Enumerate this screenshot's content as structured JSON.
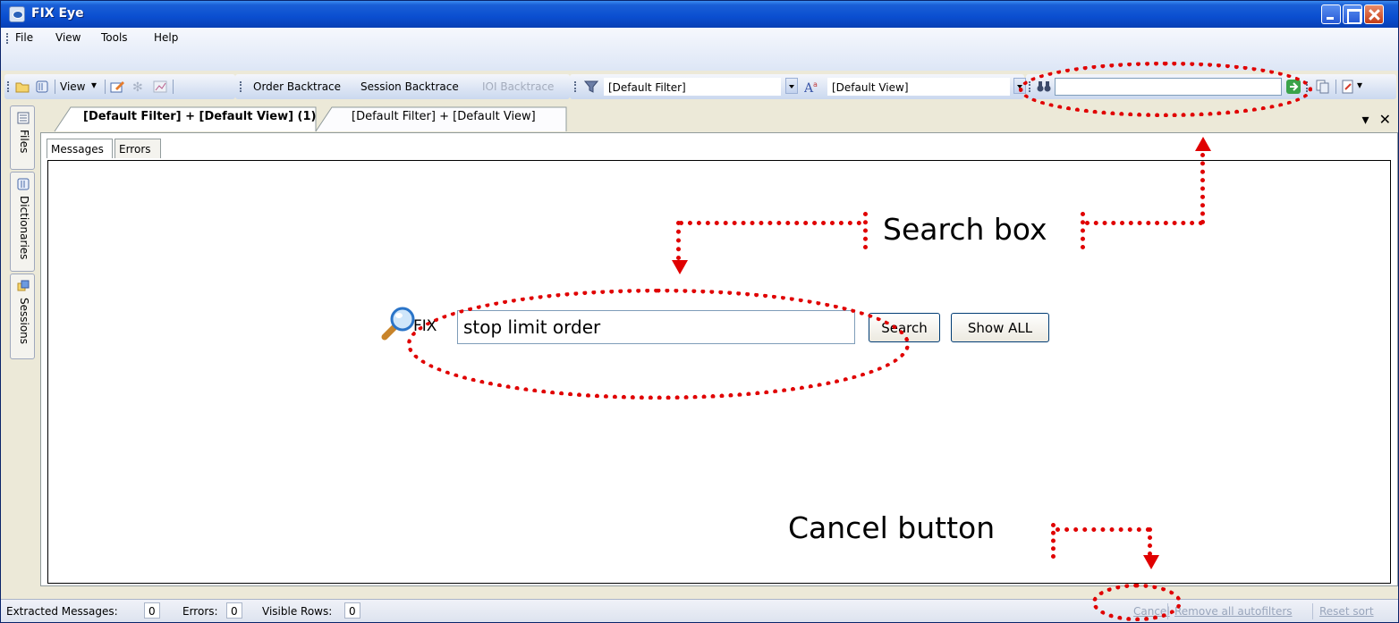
{
  "window": {
    "title": "FIX Eye"
  },
  "menu": {
    "items": [
      "File",
      "View",
      "Tools",
      "Help"
    ]
  },
  "toolbar": {
    "view_label": "View",
    "order_backtrace": "Order Backtrace",
    "session_backtrace": "Session Backtrace",
    "ioi_backtrace": "IOI Backtrace",
    "filter_value": "[Default Filter]",
    "view_value": "[Default View]",
    "search_value": ""
  },
  "sidebar": {
    "items": [
      "Files",
      "Dictionaries",
      "Sessions"
    ]
  },
  "doc_tabs": {
    "active": "[Default Filter] + [Default View] (1)",
    "inactive": "[Default Filter] + [Default View]"
  },
  "inner_tabs": [
    "Messages",
    "Errors"
  ],
  "search_panel": {
    "prefix": "FIX",
    "query": "stop limit order",
    "search_button": "Search",
    "show_all_button": "Show ALL"
  },
  "annotations": {
    "search_box": "Search box",
    "cancel_button": "Cancel button",
    "color": "#e00000"
  },
  "status": {
    "extracted_label": "Extracted Messages:",
    "extracted_value": "0",
    "errors_label": "Errors:",
    "errors_value": "0",
    "visible_label": "Visible Rows:",
    "visible_value": "0",
    "cancel": "Cancel",
    "remove_autofilters": "Remove all autofilters",
    "reset_sort": "Reset sort"
  }
}
